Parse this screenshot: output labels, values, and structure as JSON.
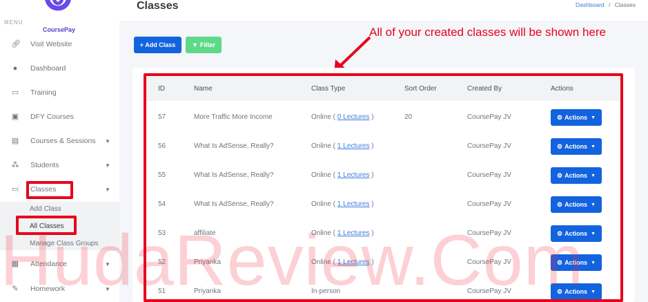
{
  "sidebar": {
    "logo_text": "CoursePay",
    "menu_label": "MENU",
    "items": [
      {
        "label": "Visit Website",
        "icon": "link-icon"
      },
      {
        "label": "Dashboard",
        "icon": "fire-icon"
      },
      {
        "label": "Training",
        "icon": "training-icon"
      },
      {
        "label": "DFY Courses",
        "icon": "gift-icon"
      },
      {
        "label": "Courses & Sessions",
        "icon": "book-icon"
      },
      {
        "label": "Students",
        "icon": "users-icon"
      },
      {
        "label": "Classes",
        "icon": "classes-icon"
      },
      {
        "label": "Attendance",
        "icon": "table-icon"
      },
      {
        "label": "Homework",
        "icon": "edit-icon"
      }
    ],
    "sub_items": [
      "Add Class",
      "All Classes",
      "Manage Class Groups"
    ]
  },
  "header": {
    "title": "Classes",
    "breadcrumb_link": "Dashboard",
    "breadcrumb_sep": "/",
    "breadcrumb_current": "Classes"
  },
  "toolbar": {
    "add_label": "+ Add Class",
    "filter_label": "Filter"
  },
  "annotation": "All of your created classes will be shown here",
  "table": {
    "columns": [
      "ID",
      "Name",
      "Class Type",
      "Sort Order",
      "Created By",
      "Actions"
    ],
    "rows": [
      {
        "id": "57",
        "name": "More Traffic More Income",
        "type_pre": "Online ( ",
        "lectures": "0 Lectures",
        "type_post": " )",
        "sort": "20",
        "by": "CoursePay JV",
        "action": "Actions"
      },
      {
        "id": "56",
        "name": "What Is AdSense, Really?",
        "type_pre": "Online ( ",
        "lectures": "1 Lectures",
        "type_post": " )",
        "sort": "",
        "by": "CoursePay JV",
        "action": "Actions"
      },
      {
        "id": "55",
        "name": "What Is AdSense, Really?",
        "type_pre": "Online ( ",
        "lectures": "1 Lectures",
        "type_post": " )",
        "sort": "",
        "by": "CoursePay JV",
        "action": "Actions"
      },
      {
        "id": "54",
        "name": "What Is AdSense, Really?",
        "type_pre": "Online ( ",
        "lectures": "1 Lectures",
        "type_post": " )",
        "sort": "",
        "by": "CoursePay JV",
        "action": "Actions"
      },
      {
        "id": "53",
        "name": "affiliate",
        "type_pre": "Online ( ",
        "lectures": "1 Lectures",
        "type_post": " )",
        "sort": "",
        "by": "CoursePay JV",
        "action": "Actions"
      },
      {
        "id": "52",
        "name": "Priyanka",
        "type_pre": "Online ( ",
        "lectures": "1 Lectures",
        "type_post": " )",
        "sort": "",
        "by": "CoursePay JV",
        "action": "Actions"
      },
      {
        "id": "51",
        "name": "Priyanka",
        "type_pre": "In-person",
        "lectures": "",
        "type_post": "",
        "sort": "",
        "by": "CoursePay JV",
        "action": "Actions"
      }
    ]
  },
  "watermark": "HudaReview.Com",
  "colors": {
    "accent": "#1363df",
    "filter": "#5ed98a",
    "annotation": "#e8001c"
  }
}
